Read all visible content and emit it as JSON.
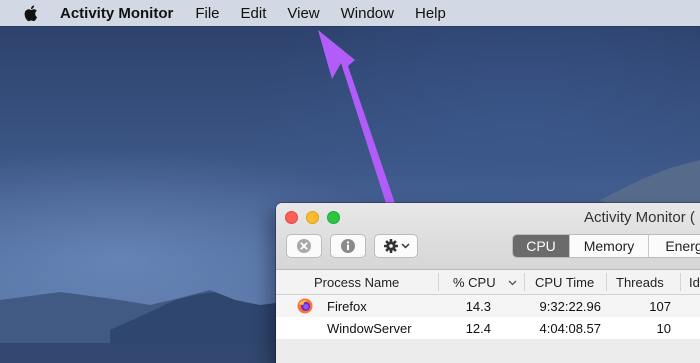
{
  "menubar": {
    "apple_icon": "apple-logo-icon",
    "app_name": "Activity Monitor",
    "items": [
      "File",
      "Edit",
      "View",
      "Window",
      "Help"
    ]
  },
  "annotation": {
    "arrow_color": "#b25dfa",
    "arrow_icon": "pointer-arrow-icon"
  },
  "window": {
    "title": "Activity Monitor (",
    "toolbar": {
      "stop_icon": "stop-process-icon",
      "info_icon": "info-icon",
      "gear_icon": "gear-icon",
      "gear_menu_icon": "chevron-down-icon"
    },
    "tabs": [
      {
        "label": "CPU",
        "active": true
      },
      {
        "label": "Memory",
        "active": false
      },
      {
        "label": "Energ",
        "active": false
      }
    ],
    "columns": {
      "process_name": "Process Name",
      "cpu": "% CPU",
      "cpu_sort_icon": "sort-descending-chevron-icon",
      "cpu_time": "CPU Time",
      "threads": "Threads",
      "idle": "Id"
    },
    "processes": [
      {
        "name": "Firefox",
        "cpu": "14.3",
        "cpu_time": "9:32:22.96",
        "threads": "107",
        "icon": "firefox-icon"
      },
      {
        "name": "WindowServer",
        "cpu": "12.4",
        "cpu_time": "4:04:08.57",
        "threads": "10",
        "icon": ""
      }
    ]
  },
  "colors": {
    "desktop_top": "#2b3f69",
    "desktop_bottom": "#5a77a6",
    "menubar_bg": "#dadfe9",
    "active_tab_bg": "#6b6b6b"
  }
}
